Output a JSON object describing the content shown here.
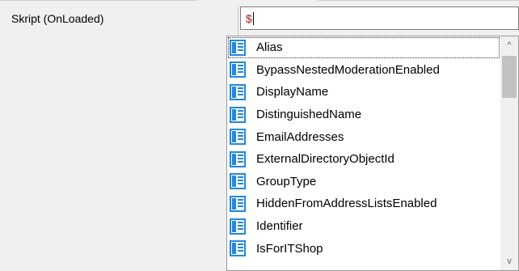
{
  "property": {
    "label": "Skript (OnLoaded)"
  },
  "editor": {
    "value": "$"
  },
  "autocomplete": {
    "items": [
      {
        "label": "Alias",
        "icon": "property-icon"
      },
      {
        "label": "BypassNestedModerationEnabled",
        "icon": "property-icon"
      },
      {
        "label": "DisplayName",
        "icon": "property-icon"
      },
      {
        "label": "DistinguishedName",
        "icon": "property-icon"
      },
      {
        "label": "EmailAddresses",
        "icon": "property-icon"
      },
      {
        "label": "ExternalDirectoryObjectId",
        "icon": "property-icon"
      },
      {
        "label": "GroupType",
        "icon": "property-icon"
      },
      {
        "label": "HiddenFromAddressListsEnabled",
        "icon": "property-icon"
      },
      {
        "label": "Identifier",
        "icon": "property-icon"
      },
      {
        "label": "IsForITShop",
        "icon": "property-icon"
      }
    ],
    "selected_index": 0,
    "scroll_up_glyph": "^",
    "scroll_down_glyph": "v"
  },
  "colors": {
    "icon_blue": "#1e88e5",
    "dollar_red": "#a31515"
  }
}
